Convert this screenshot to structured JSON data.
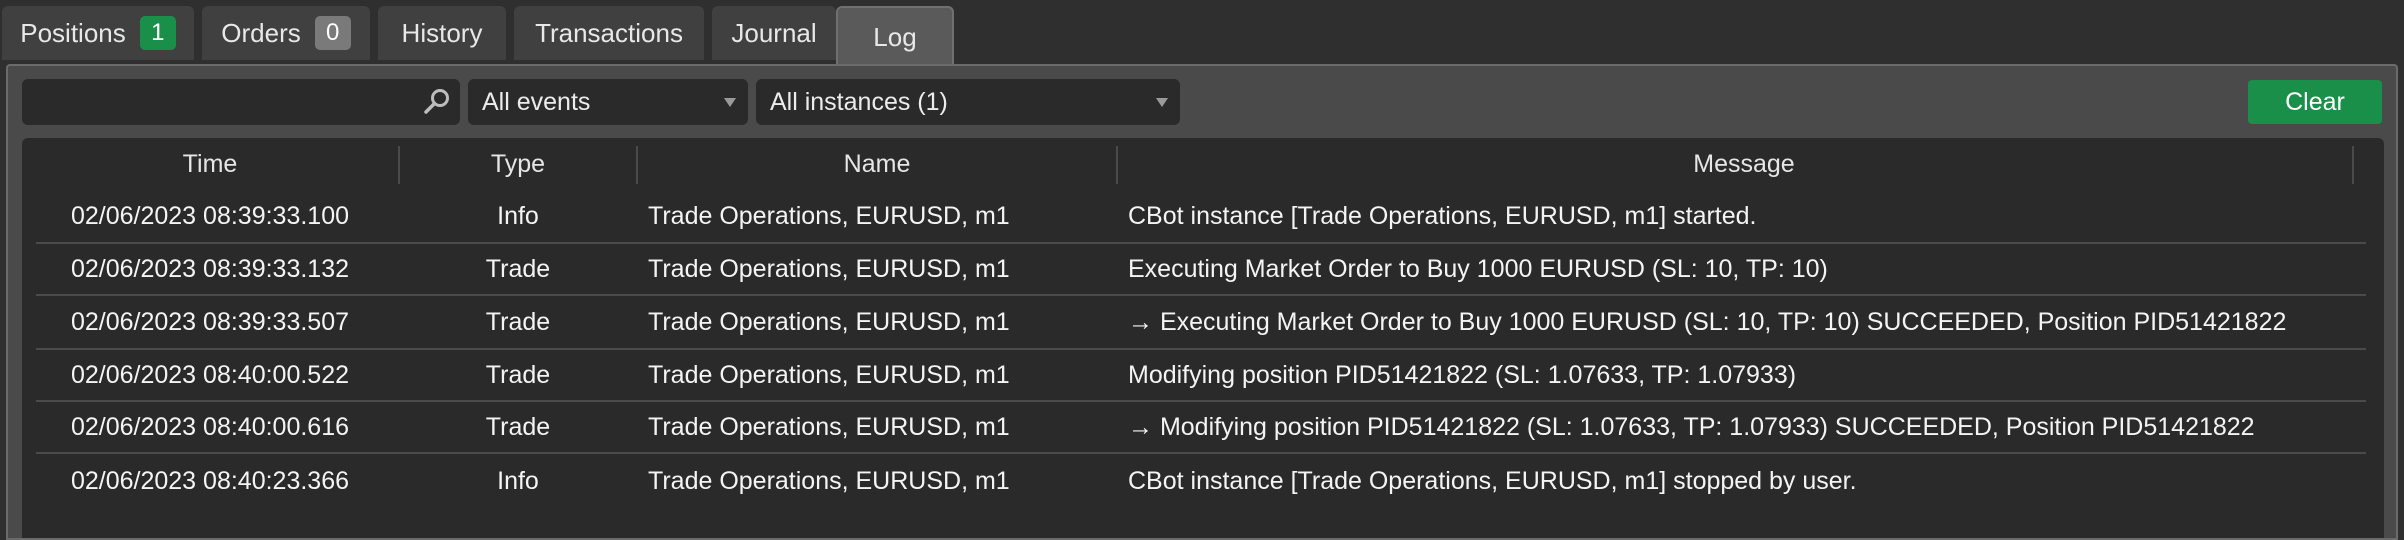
{
  "tabs": [
    {
      "label": "Positions",
      "badge": "1"
    },
    {
      "label": "Orders",
      "badge": "0"
    },
    {
      "label": "History"
    },
    {
      "label": "Transactions"
    },
    {
      "label": "Journal"
    },
    {
      "label": "Log",
      "active": true
    }
  ],
  "toolbar": {
    "search_value": "",
    "events_filter": "All events",
    "instances_filter": "All instances (1)",
    "clear_label": "Clear"
  },
  "colors": {
    "accent_green": "#1a8f4a",
    "background": "#2f2f2f",
    "grid_background": "#2a2a2a"
  },
  "table": {
    "columns": [
      "Time",
      "Type",
      "Name",
      "Message"
    ],
    "rows": [
      {
        "time": "02/06/2023 08:39:33.100",
        "type": "Info",
        "name": "Trade Operations, EURUSD, m1",
        "message": "CBot instance [Trade Operations, EURUSD, m1] started."
      },
      {
        "time": "02/06/2023 08:39:33.132",
        "type": "Trade",
        "name": "Trade Operations, EURUSD, m1",
        "message": "Executing Market Order to Buy 1000 EURUSD (SL: 10, TP: 10)"
      },
      {
        "time": "02/06/2023 08:39:33.507",
        "type": "Trade",
        "name": "Trade Operations, EURUSD, m1",
        "message": "→ Executing Market Order to Buy 1000 EURUSD (SL: 10, TP: 10) SUCCEEDED, Position PID51421822"
      },
      {
        "time": "02/06/2023 08:40:00.522",
        "type": "Trade",
        "name": "Trade Operations, EURUSD, m1",
        "message": "Modifying position PID51421822 (SL: 1.07633, TP: 1.07933)"
      },
      {
        "time": "02/06/2023 08:40:00.616",
        "type": "Trade",
        "name": "Trade Operations, EURUSD, m1",
        "message": "→ Modifying position PID51421822 (SL: 1.07633, TP: 1.07933) SUCCEEDED, Position PID51421822"
      },
      {
        "time": "02/06/2023 08:40:23.366",
        "type": "Info",
        "name": "Trade Operations, EURUSD, m1",
        "message": "CBot instance [Trade Operations, EURUSD, m1] stopped by user."
      }
    ]
  }
}
